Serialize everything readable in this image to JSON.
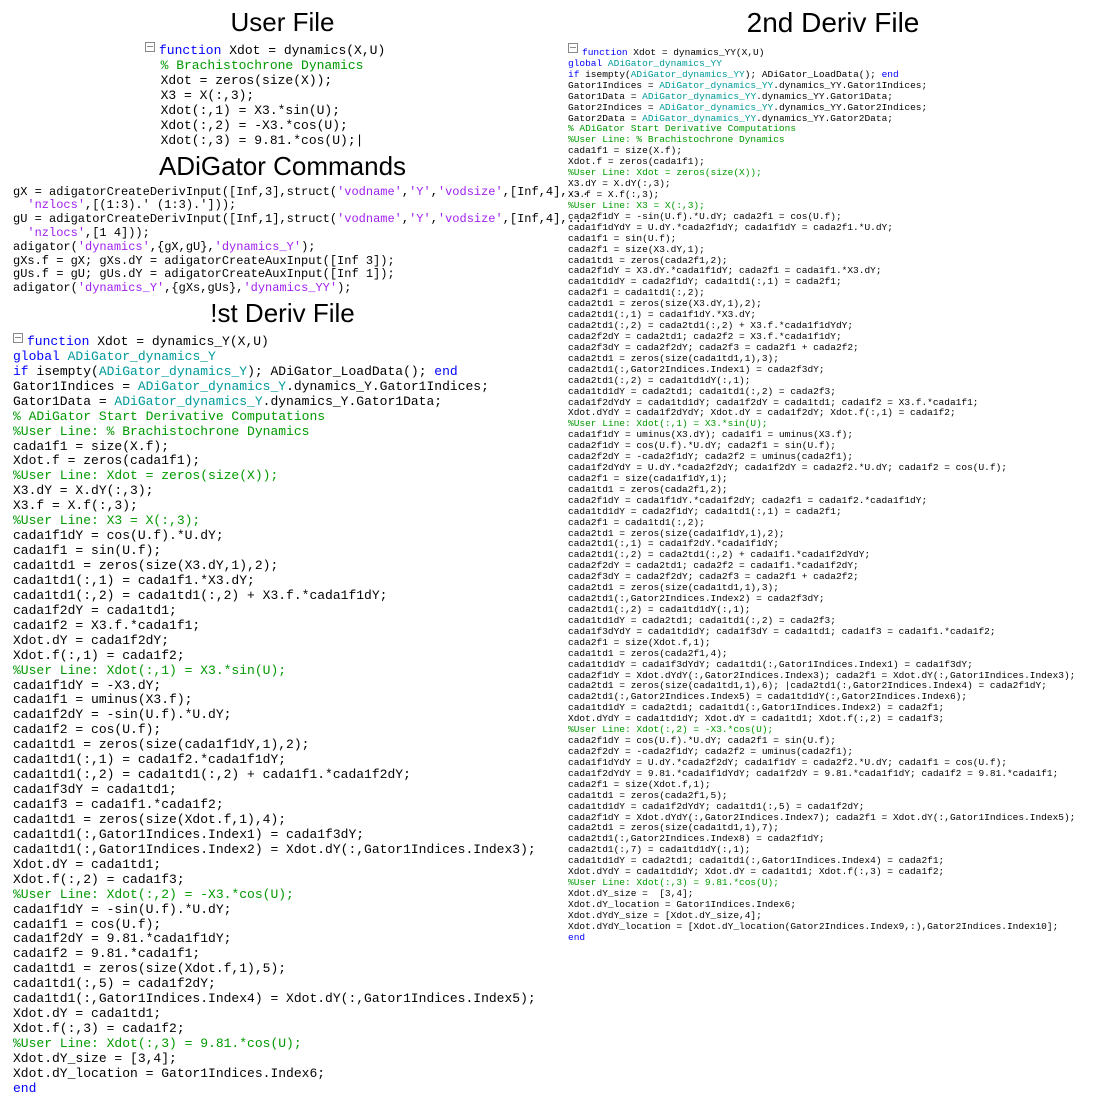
{
  "headings": {
    "user_file": "User File",
    "adigator_cmds": "ADiGator Commands",
    "first_deriv": "!st Deriv File",
    "second_deriv": "2nd Deriv File"
  },
  "code": {
    "user_file": [
      {
        "t": "raw",
        "html": "<span class='minus-box'></span><span class='kw'>function</span> Xdot = dynamics(X,U)"
      },
      {
        "t": "com",
        "text": "  % Brachistochrone Dynamics"
      },
      {
        "t": "plain",
        "text": "  Xdot = zeros(size(X));"
      },
      {
        "t": "plain",
        "text": "  X3 = X(:,3);"
      },
      {
        "t": "plain",
        "text": "  Xdot(:,1) = X3.*sin(U);"
      },
      {
        "t": "plain",
        "text": "  Xdot(:,2) = -X3.*cos(U);"
      },
      {
        "t": "plain",
        "text": "  Xdot(:,3) = 9.81.*cos(U);|"
      }
    ],
    "adigator_cmds": [
      {
        "t": "raw",
        "html": "gX = adigatorCreateDerivInput([Inf,3],struct(<span class='str'>'vodname'</span>,<span class='str'>'Y'</span>,<span class='str'>'vodsize'</span>,[Inf,4],..."
      },
      {
        "t": "raw",
        "html": "  <span class='str'>'nzlocs'</span>,[(1:3).' (1:3).']));"
      },
      {
        "t": "raw",
        "html": "gU = adigatorCreateDerivInput([Inf,1],struct(<span class='str'>'vodname'</span>,<span class='str'>'Y'</span>,<span class='str'>'vodsize'</span>,[Inf,4],..."
      },
      {
        "t": "raw",
        "html": "  <span class='str'>'nzlocs'</span>,[1 4]));"
      },
      {
        "t": "raw",
        "html": "adigator(<span class='str'>'dynamics'</span>,{gX,gU},<span class='str'>'dynamics_Y'</span>);"
      },
      {
        "t": "plain",
        "text": "gXs.f = gX; gXs.dY = adigatorCreateAuxInput([Inf 3]);"
      },
      {
        "t": "plain",
        "text": "gUs.f = gU; gUs.dY = adigatorCreateAuxInput([Inf 1]);"
      },
      {
        "t": "raw",
        "html": "adigator(<span class='str'>'dynamics_Y'</span>,{gXs,gUs},<span class='str'>'dynamics_YY'</span>);"
      }
    ],
    "first_deriv": [
      {
        "t": "raw",
        "html": "<span class='minus-box'></span><span class='kw'>function</span> Xdot = dynamics_Y(X,U)"
      },
      {
        "t": "raw",
        "html": "<span class='kw'>global</span> <span class='global-var'>ADiGator_dynamics_Y</span>"
      },
      {
        "t": "raw",
        "html": "<span class='kw'>if</span> isempty(<span class='global-var'>ADiGator_dynamics_Y</span>); ADiGator_LoadData(); <span class='kw'>end</span>"
      },
      {
        "t": "raw",
        "html": "Gator1Indices = <span class='global-var'>ADiGator_dynamics_Y</span>.dynamics_Y.Gator1Indices;"
      },
      {
        "t": "raw",
        "html": "Gator1Data = <span class='global-var'>ADiGator_dynamics_Y</span>.dynamics_Y.Gator1Data;"
      },
      {
        "t": "com",
        "text": "% ADiGator Start Derivative Computations"
      },
      {
        "t": "com",
        "text": "%User Line: % Brachistochrone Dynamics"
      },
      {
        "t": "plain",
        "text": "cada1f1 = size(X.f);"
      },
      {
        "t": "plain",
        "text": "Xdot.f = zeros(cada1f1);"
      },
      {
        "t": "com",
        "text": "%User Line: Xdot = zeros(size(X));"
      },
      {
        "t": "plain",
        "text": "X3.dY = X.dY(:,3);"
      },
      {
        "t": "plain",
        "text": "X3.f = X.f(:,3);"
      },
      {
        "t": "com",
        "text": "%User Line: X3 = X(:,3);"
      },
      {
        "t": "plain",
        "text": "cada1f1dY = cos(U.f).*U.dY;"
      },
      {
        "t": "plain",
        "text": "cada1f1 = sin(U.f);"
      },
      {
        "t": "plain",
        "text": "cada1td1 = zeros(size(X3.dY,1),2);"
      },
      {
        "t": "plain",
        "text": "cada1td1(:,1) = cada1f1.*X3.dY;"
      },
      {
        "t": "plain",
        "text": "cada1td1(:,2) = cada1td1(:,2) + X3.f.*cada1f1dY;"
      },
      {
        "t": "plain",
        "text": "cada1f2dY = cada1td1;"
      },
      {
        "t": "plain",
        "text": "cada1f2 = X3.f.*cada1f1;"
      },
      {
        "t": "plain",
        "text": "Xdot.dY = cada1f2dY;"
      },
      {
        "t": "plain",
        "text": "Xdot.f(:,1) = cada1f2;"
      },
      {
        "t": "com",
        "text": "%User Line: Xdot(:,1) = X3.*sin(U);"
      },
      {
        "t": "plain",
        "text": "cada1f1dY = -X3.dY;"
      },
      {
        "t": "plain",
        "text": "cada1f1 = uminus(X3.f);"
      },
      {
        "t": "plain",
        "text": "cada1f2dY = -sin(U.f).*U.dY;"
      },
      {
        "t": "plain",
        "text": "cada1f2 = cos(U.f);"
      },
      {
        "t": "plain",
        "text": "cada1td1 = zeros(size(cada1f1dY,1),2);"
      },
      {
        "t": "plain",
        "text": "cada1td1(:,1) = cada1f2.*cada1f1dY;"
      },
      {
        "t": "plain",
        "text": "cada1td1(:,2) = cada1td1(:,2) + cada1f1.*cada1f2dY;"
      },
      {
        "t": "plain",
        "text": "cada1f3dY = cada1td1;"
      },
      {
        "t": "plain",
        "text": "cada1f3 = cada1f1.*cada1f2;"
      },
      {
        "t": "plain",
        "text": "cada1td1 = zeros(size(Xdot.f,1),4);"
      },
      {
        "t": "plain",
        "text": "cada1td1(:,Gator1Indices.Index1) = cada1f3dY;"
      },
      {
        "t": "plain",
        "text": "cada1td1(:,Gator1Indices.Index2) = Xdot.dY(:,Gator1Indices.Index3);"
      },
      {
        "t": "plain",
        "text": "Xdot.dY = cada1td1;"
      },
      {
        "t": "plain",
        "text": "Xdot.f(:,2) = cada1f3;"
      },
      {
        "t": "com",
        "text": "%User Line: Xdot(:,2) = -X3.*cos(U);"
      },
      {
        "t": "plain",
        "text": "cada1f1dY = -sin(U.f).*U.dY;"
      },
      {
        "t": "plain",
        "text": "cada1f1 = cos(U.f);"
      },
      {
        "t": "plain",
        "text": "cada1f2dY = 9.81.*cada1f1dY;"
      },
      {
        "t": "plain",
        "text": "cada1f2 = 9.81.*cada1f1;"
      },
      {
        "t": "plain",
        "text": "cada1td1 = zeros(size(Xdot.f,1),5);"
      },
      {
        "t": "plain",
        "text": "cada1td1(:,5) = cada1f2dY;"
      },
      {
        "t": "plain",
        "text": "cada1td1(:,Gator1Indices.Index4) = Xdot.dY(:,Gator1Indices.Index5);"
      },
      {
        "t": "plain",
        "text": "Xdot.dY = cada1td1;"
      },
      {
        "t": "plain",
        "text": "Xdot.f(:,3) = cada1f2;"
      },
      {
        "t": "com",
        "text": "%User Line: Xdot(:,3) = 9.81.*cos(U);"
      },
      {
        "t": "plain",
        "text": "Xdot.dY_size = [3,4];"
      },
      {
        "t": "plain",
        "text": "Xdot.dY_location = Gator1Indices.Index6;"
      },
      {
        "t": "raw",
        "html": "<span class='kw'>end</span>"
      }
    ],
    "second_deriv": [
      {
        "t": "raw",
        "html": "<span class='minus-box'></span><span class='kw'>function</span> Xdot = dynamics_YY(X,U)"
      },
      {
        "t": "raw",
        "html": "<span class='kw'>global</span> <span class='global-var'>ADiGator_dynamics_YY</span>"
      },
      {
        "t": "raw",
        "html": "<span class='kw'>if</span> isempty(<span class='global-var'>ADiGator_dynamics_YY</span>); ADiGator_LoadData(); <span class='kw'>end</span>"
      },
      {
        "t": "raw",
        "html": "Gator1Indices = <span class='global-var'>ADiGator_dynamics_YY</span>.dynamics_YY.Gator1Indices;"
      },
      {
        "t": "raw",
        "html": "Gator1Data = <span class='global-var'>ADiGator_dynamics_YY</span>.dynamics_YY.Gator1Data;"
      },
      {
        "t": "raw",
        "html": "Gator2Indices = <span class='global-var'>ADiGator_dynamics_YY</span>.dynamics_YY.Gator2Indices;"
      },
      {
        "t": "raw",
        "html": "Gator2Data = <span class='global-var'>ADiGator_dynamics_YY</span>.dynamics_YY.Gator2Data;"
      },
      {
        "t": "com",
        "text": "% ADiGator Start Derivative Computations"
      },
      {
        "t": "com",
        "text": "%User Line: % Brachistochrone Dynamics"
      },
      {
        "t": "plain",
        "text": "cada1f1 = size(X.f);"
      },
      {
        "t": "plain",
        "text": "Xdot.f = zeros(cada1f1);"
      },
      {
        "t": "com",
        "text": "%User Line: Xdot = zeros(size(X));"
      },
      {
        "t": "plain",
        "text": "X3.dY = X.dY(:,3);"
      },
      {
        "t": "plain",
        "text": "X3.f = X.f(:,3);"
      },
      {
        "t": "com",
        "text": "%User Line: X3 = X(:,3);"
      },
      {
        "t": "plain",
        "text": "cada2f1dY = -sin(U.f).*U.dY; cada2f1 = cos(U.f);"
      },
      {
        "t": "plain",
        "text": "cada1f1dYdY = U.dY.*cada2f1dY; cada1f1dY = cada2f1.*U.dY;"
      },
      {
        "t": "plain",
        "text": "cada1f1 = sin(U.f);"
      },
      {
        "t": "plain",
        "text": "cada2f1 = size(X3.dY,1);"
      },
      {
        "t": "plain",
        "text": "cada1td1 = zeros(cada2f1,2);"
      },
      {
        "t": "plain",
        "text": "cada2f1dY = X3.dY.*cada1f1dY; cada2f1 = cada1f1.*X3.dY;"
      },
      {
        "t": "plain",
        "text": "cada1td1dY = cada2f1dY; cada1td1(:,1) = cada2f1;"
      },
      {
        "t": "plain",
        "text": "cada2f1 = cada1td1(:,2);"
      },
      {
        "t": "plain",
        "text": "cada2td1 = zeros(size(X3.dY,1),2);"
      },
      {
        "t": "plain",
        "text": "cada2td1(:,1) = cada1f1dY.*X3.dY;"
      },
      {
        "t": "plain",
        "text": "cada2td1(:,2) = cada2td1(:,2) + X3.f.*cada1f1dYdY;"
      },
      {
        "t": "plain",
        "text": "cada2f2dY = cada2td1; cada2f2 = X3.f.*cada1f1dY;"
      },
      {
        "t": "plain",
        "text": "cada2f3dY = cada2f2dY; cada2f3 = cada2f1 + cada2f2;"
      },
      {
        "t": "plain",
        "text": "cada2td1 = zeros(size(cada1td1,1),3);"
      },
      {
        "t": "plain",
        "text": "cada2td1(:,Gator2Indices.Index1) = cada2f3dY;"
      },
      {
        "t": "plain",
        "text": "cada2td1(:,2) = cada1td1dY(:,1);"
      },
      {
        "t": "plain",
        "text": "cada1td1dY = cada2td1; cada1td1(:,2) = cada2f3;"
      },
      {
        "t": "plain",
        "text": "cada1f2dYdY = cada1td1dY; cada1f2dY = cada1td1; cada1f2 = X3.f.*cada1f1;"
      },
      {
        "t": "plain",
        "text": "Xdot.dYdY = cada1f2dYdY; Xdot.dY = cada1f2dY; Xdot.f(:,1) = cada1f2;"
      },
      {
        "t": "com",
        "text": "%User Line: Xdot(:,1) = X3.*sin(U);"
      },
      {
        "t": "plain",
        "text": "cada1f1dY = uminus(X3.dY); cada1f1 = uminus(X3.f);"
      },
      {
        "t": "plain",
        "text": "cada2f1dY = cos(U.f).*U.dY; cada2f1 = sin(U.f);"
      },
      {
        "t": "plain",
        "text": "cada2f2dY = -cada2f1dY; cada2f2 = uminus(cada2f1);"
      },
      {
        "t": "plain",
        "text": "cada1f2dYdY = U.dY.*cada2f2dY; cada1f2dY = cada2f2.*U.dY; cada1f2 = cos(U.f);"
      },
      {
        "t": "plain",
        "text": "cada2f1 = size(cada1f1dY,1);"
      },
      {
        "t": "plain",
        "text": "cada1td1 = zeros(cada2f1,2);"
      },
      {
        "t": "plain",
        "text": "cada2f1dY = cada1f1dY.*cada1f2dY; cada2f1 = cada1f2.*cada1f1dY;"
      },
      {
        "t": "plain",
        "text": "cada1td1dY = cada2f1dY; cada1td1(:,1) = cada2f1;"
      },
      {
        "t": "plain",
        "text": "cada2f1 = cada1td1(:,2);"
      },
      {
        "t": "plain",
        "text": "cada2td1 = zeros(size(cada1f1dY,1),2);"
      },
      {
        "t": "plain",
        "text": "cada2td1(:,1) = cada1f2dY.*cada1f1dY;"
      },
      {
        "t": "plain",
        "text": "cada2td1(:,2) = cada2td1(:,2) + cada1f1.*cada1f2dYdY;"
      },
      {
        "t": "plain",
        "text": "cada2f2dY = cada2td1; cada2f2 = cada1f1.*cada1f2dY;"
      },
      {
        "t": "plain",
        "text": "cada2f3dY = cada2f2dY; cada2f3 = cada2f1 + cada2f2;"
      },
      {
        "t": "plain",
        "text": "cada2td1 = zeros(size(cada1td1,1),3);"
      },
      {
        "t": "plain",
        "text": "cada2td1(:,Gator2Indices.Index2) = cada2f3dY;"
      },
      {
        "t": "plain",
        "text": "cada2td1(:,2) = cada1td1dY(:,1);"
      },
      {
        "t": "plain",
        "text": "cada1td1dY = cada2td1; cada1td1(:,2) = cada2f3;"
      },
      {
        "t": "plain",
        "text": "cada1f3dYdY = cada1td1dY; cada1f3dY = cada1td1; cada1f3 = cada1f1.*cada1f2;"
      },
      {
        "t": "plain",
        "text": "cada2f1 = size(Xdot.f,1);"
      },
      {
        "t": "plain",
        "text": "cada1td1 = zeros(cada2f1,4);"
      },
      {
        "t": "plain",
        "text": "cada1td1dY = cada1f3dYdY; cada1td1(:,Gator1Indices.Index1) = cada1f3dY;"
      },
      {
        "t": "plain",
        "text": "cada2f1dY = Xdot.dYdY(:,Gator2Indices.Index3); cada2f1 = Xdot.dY(:,Gator1Indices.Index3);"
      },
      {
        "t": "plain",
        "text": "cada2td1 = zeros(size(cada1td1,1),6); |cada2td1(:,Gator2Indices.Index4) = cada2f1dY;"
      },
      {
        "t": "plain",
        "text": "cada2td1(:,Gator2Indices.Index5) = cada1td1dY(:,Gator2Indices.Index6);"
      },
      {
        "t": "plain",
        "text": "cada1td1dY = cada2td1; cada1td1(:,Gator1Indices.Index2) = cada2f1;"
      },
      {
        "t": "plain",
        "text": "Xdot.dYdY = cada1td1dY; Xdot.dY = cada1td1; Xdot.f(:,2) = cada1f3;"
      },
      {
        "t": "com",
        "text": "%User Line: Xdot(:,2) = -X3.*cos(U);"
      },
      {
        "t": "plain",
        "text": "cada2f1dY = cos(U.f).*U.dY; cada2f1 = sin(U.f);"
      },
      {
        "t": "plain",
        "text": "cada2f2dY = -cada2f1dY; cada2f2 = uminus(cada2f1);"
      },
      {
        "t": "plain",
        "text": "cada1f1dYdY = U.dY.*cada2f2dY; cada1f1dY = cada2f2.*U.dY; cada1f1 = cos(U.f);"
      },
      {
        "t": "plain",
        "text": "cada1f2dYdY = 9.81.*cada1f1dYdY; cada1f2dY = 9.81.*cada1f1dY; cada1f2 = 9.81.*cada1f1;"
      },
      {
        "t": "plain",
        "text": "cada2f1 = size(Xdot.f,1);"
      },
      {
        "t": "plain",
        "text": "cada1td1 = zeros(cada2f1,5);"
      },
      {
        "t": "plain",
        "text": "cada1td1dY = cada1f2dYdY; cada1td1(:,5) = cada1f2dY;"
      },
      {
        "t": "plain",
        "text": "cada2f1dY = Xdot.dYdY(:,Gator2Indices.Index7); cada2f1 = Xdot.dY(:,Gator1Indices.Index5);"
      },
      {
        "t": "plain",
        "text": "cada2td1 = zeros(size(cada1td1,1),7);"
      },
      {
        "t": "plain",
        "text": "cada2td1(:,Gator2Indices.Index8) = cada2f1dY;"
      },
      {
        "t": "plain",
        "text": "cada2td1(:,7) = cada1td1dY(:,1);"
      },
      {
        "t": "plain",
        "text": "cada1td1dY = cada2td1; cada1td1(:,Gator1Indices.Index4) = cada2f1;"
      },
      {
        "t": "plain",
        "text": "Xdot.dYdY = cada1td1dY; Xdot.dY = cada1td1; Xdot.f(:,3) = cada1f2;"
      },
      {
        "t": "com",
        "text": "%User Line: Xdot(:,3) = 9.81.*cos(U);"
      },
      {
        "t": "plain",
        "text": "Xdot.dY_size =  [3,4];"
      },
      {
        "t": "plain",
        "text": "Xdot.dY_location = Gator1Indices.Index6;"
      },
      {
        "t": "plain",
        "text": "Xdot.dYdY_size = [Xdot.dY_size,4];"
      },
      {
        "t": "plain",
        "text": "Xdot.dYdY_location = [Xdot.dY_location(Gator2Indices.Index9,:),Gator2Indices.Index10];"
      },
      {
        "t": "raw",
        "html": "<span class='kw'>end</span>"
      }
    ]
  }
}
